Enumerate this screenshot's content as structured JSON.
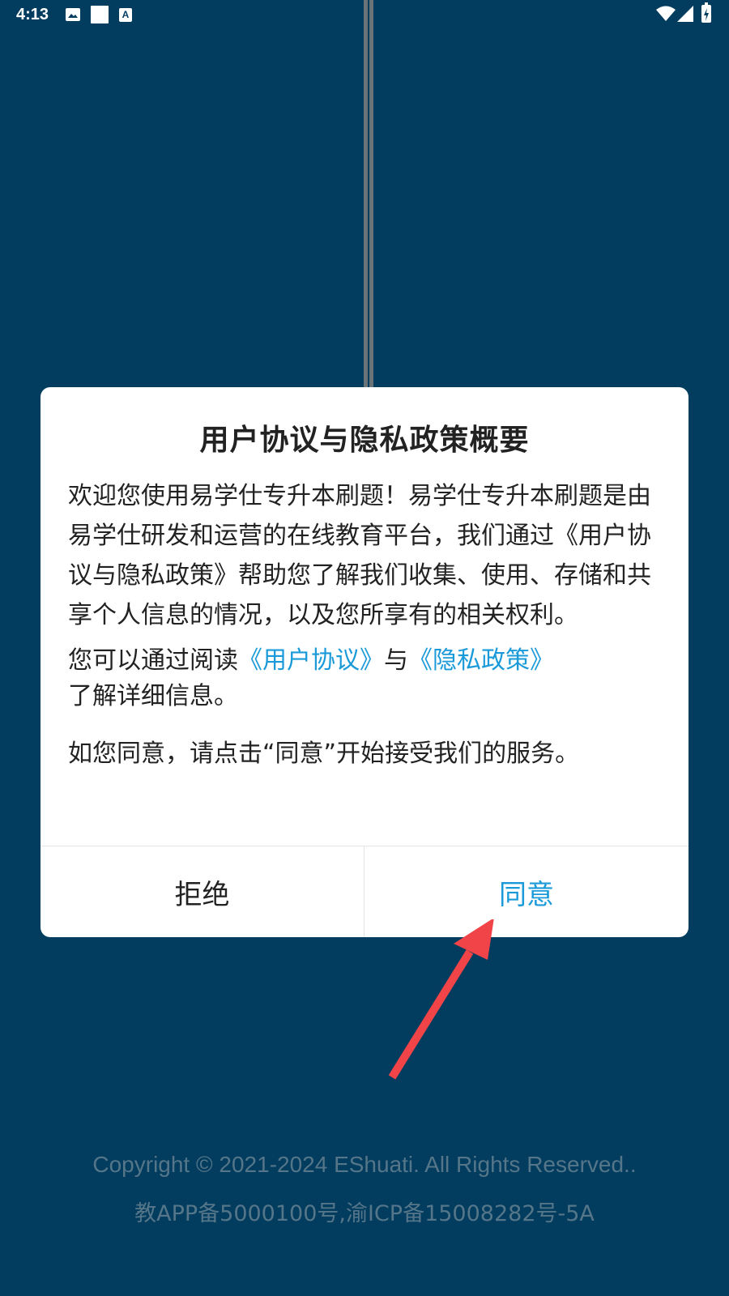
{
  "status_bar": {
    "time": "4:13",
    "icons": [
      "image-icon",
      "square-icon",
      "a-icon",
      "wifi-icon",
      "signal-icon",
      "battery-charging-icon"
    ]
  },
  "dialog": {
    "title": "用户协议与隐私政策概要",
    "paragraph_1": "欢迎您使用易学仕专升本刷题！易学仕专升本刷题是由易学仕研发和运营的在线教育平台，我们通过《用户协议与隐私政策》帮助您了解我们收集、使用、存储和共享个人信息的情况，以及您所享有的相关权利。",
    "paragraph_2": {
      "prefix": "您可以通过阅读",
      "user_agreement_link": "《用户协议》",
      "joiner": "与",
      "privacy_policy_link": "《隐私政策》",
      "suffix": "了解详细信息。"
    },
    "paragraph_3": "如您同意，请点击“同意”开始接受我们的服务。",
    "reject_label": "拒绝",
    "agree_label": "同意"
  },
  "footer": {
    "copyright": "Copyright © 2021-2024  EShuati. All Rights Reserved..",
    "icp": "教APP备5000100号,渝ICP备15008282号-5A"
  },
  "colors": {
    "background": "#023c5f",
    "link": "#1a9ad9",
    "arrow": "#f04448",
    "footer_text": "#557689"
  }
}
